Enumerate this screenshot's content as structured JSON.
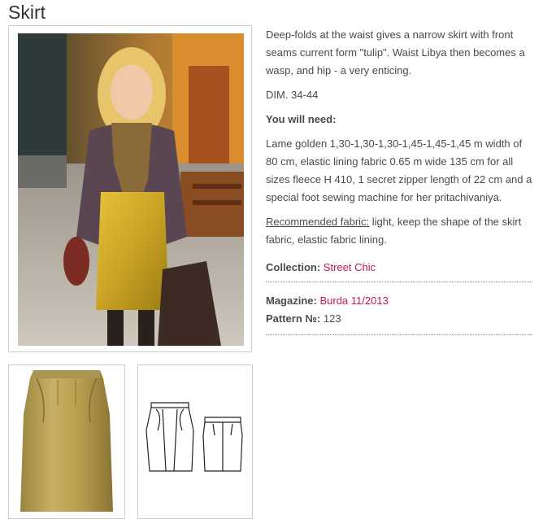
{
  "title": "Skirt",
  "description": "Deep-folds at the waist gives a narrow skirt with front seams current form \"tulip\". Waist Libya then becomes a wasp, and hip - a very enticing.",
  "dim": "DIM. 34-44",
  "need_heading": "You will need:",
  "materials": "Lame golden 1,30-1,30-1,30-1,45-1,45-1,45 m width of 80 cm, elastic lining fabric 0.65 m wide 135 cm for all sizes fleece H 410, 1 secret zipper length of 22 cm and a special foot sewing machine for her pritachivaniya.",
  "recommended": {
    "label": "Recommended fabric:",
    "text": " light, keep the shape of the skirt fabric, elastic fabric lining."
  },
  "collection": {
    "label": "Collection:",
    "value": "Street Chic"
  },
  "magazine": {
    "label": "Magazine:",
    "value": "Burda 11/2013"
  },
  "pattern": {
    "label": "Pattern №:",
    "value": "123"
  },
  "colors": {
    "link": "#c8194b",
    "text": "#4a4a4a",
    "title": "#333333"
  }
}
